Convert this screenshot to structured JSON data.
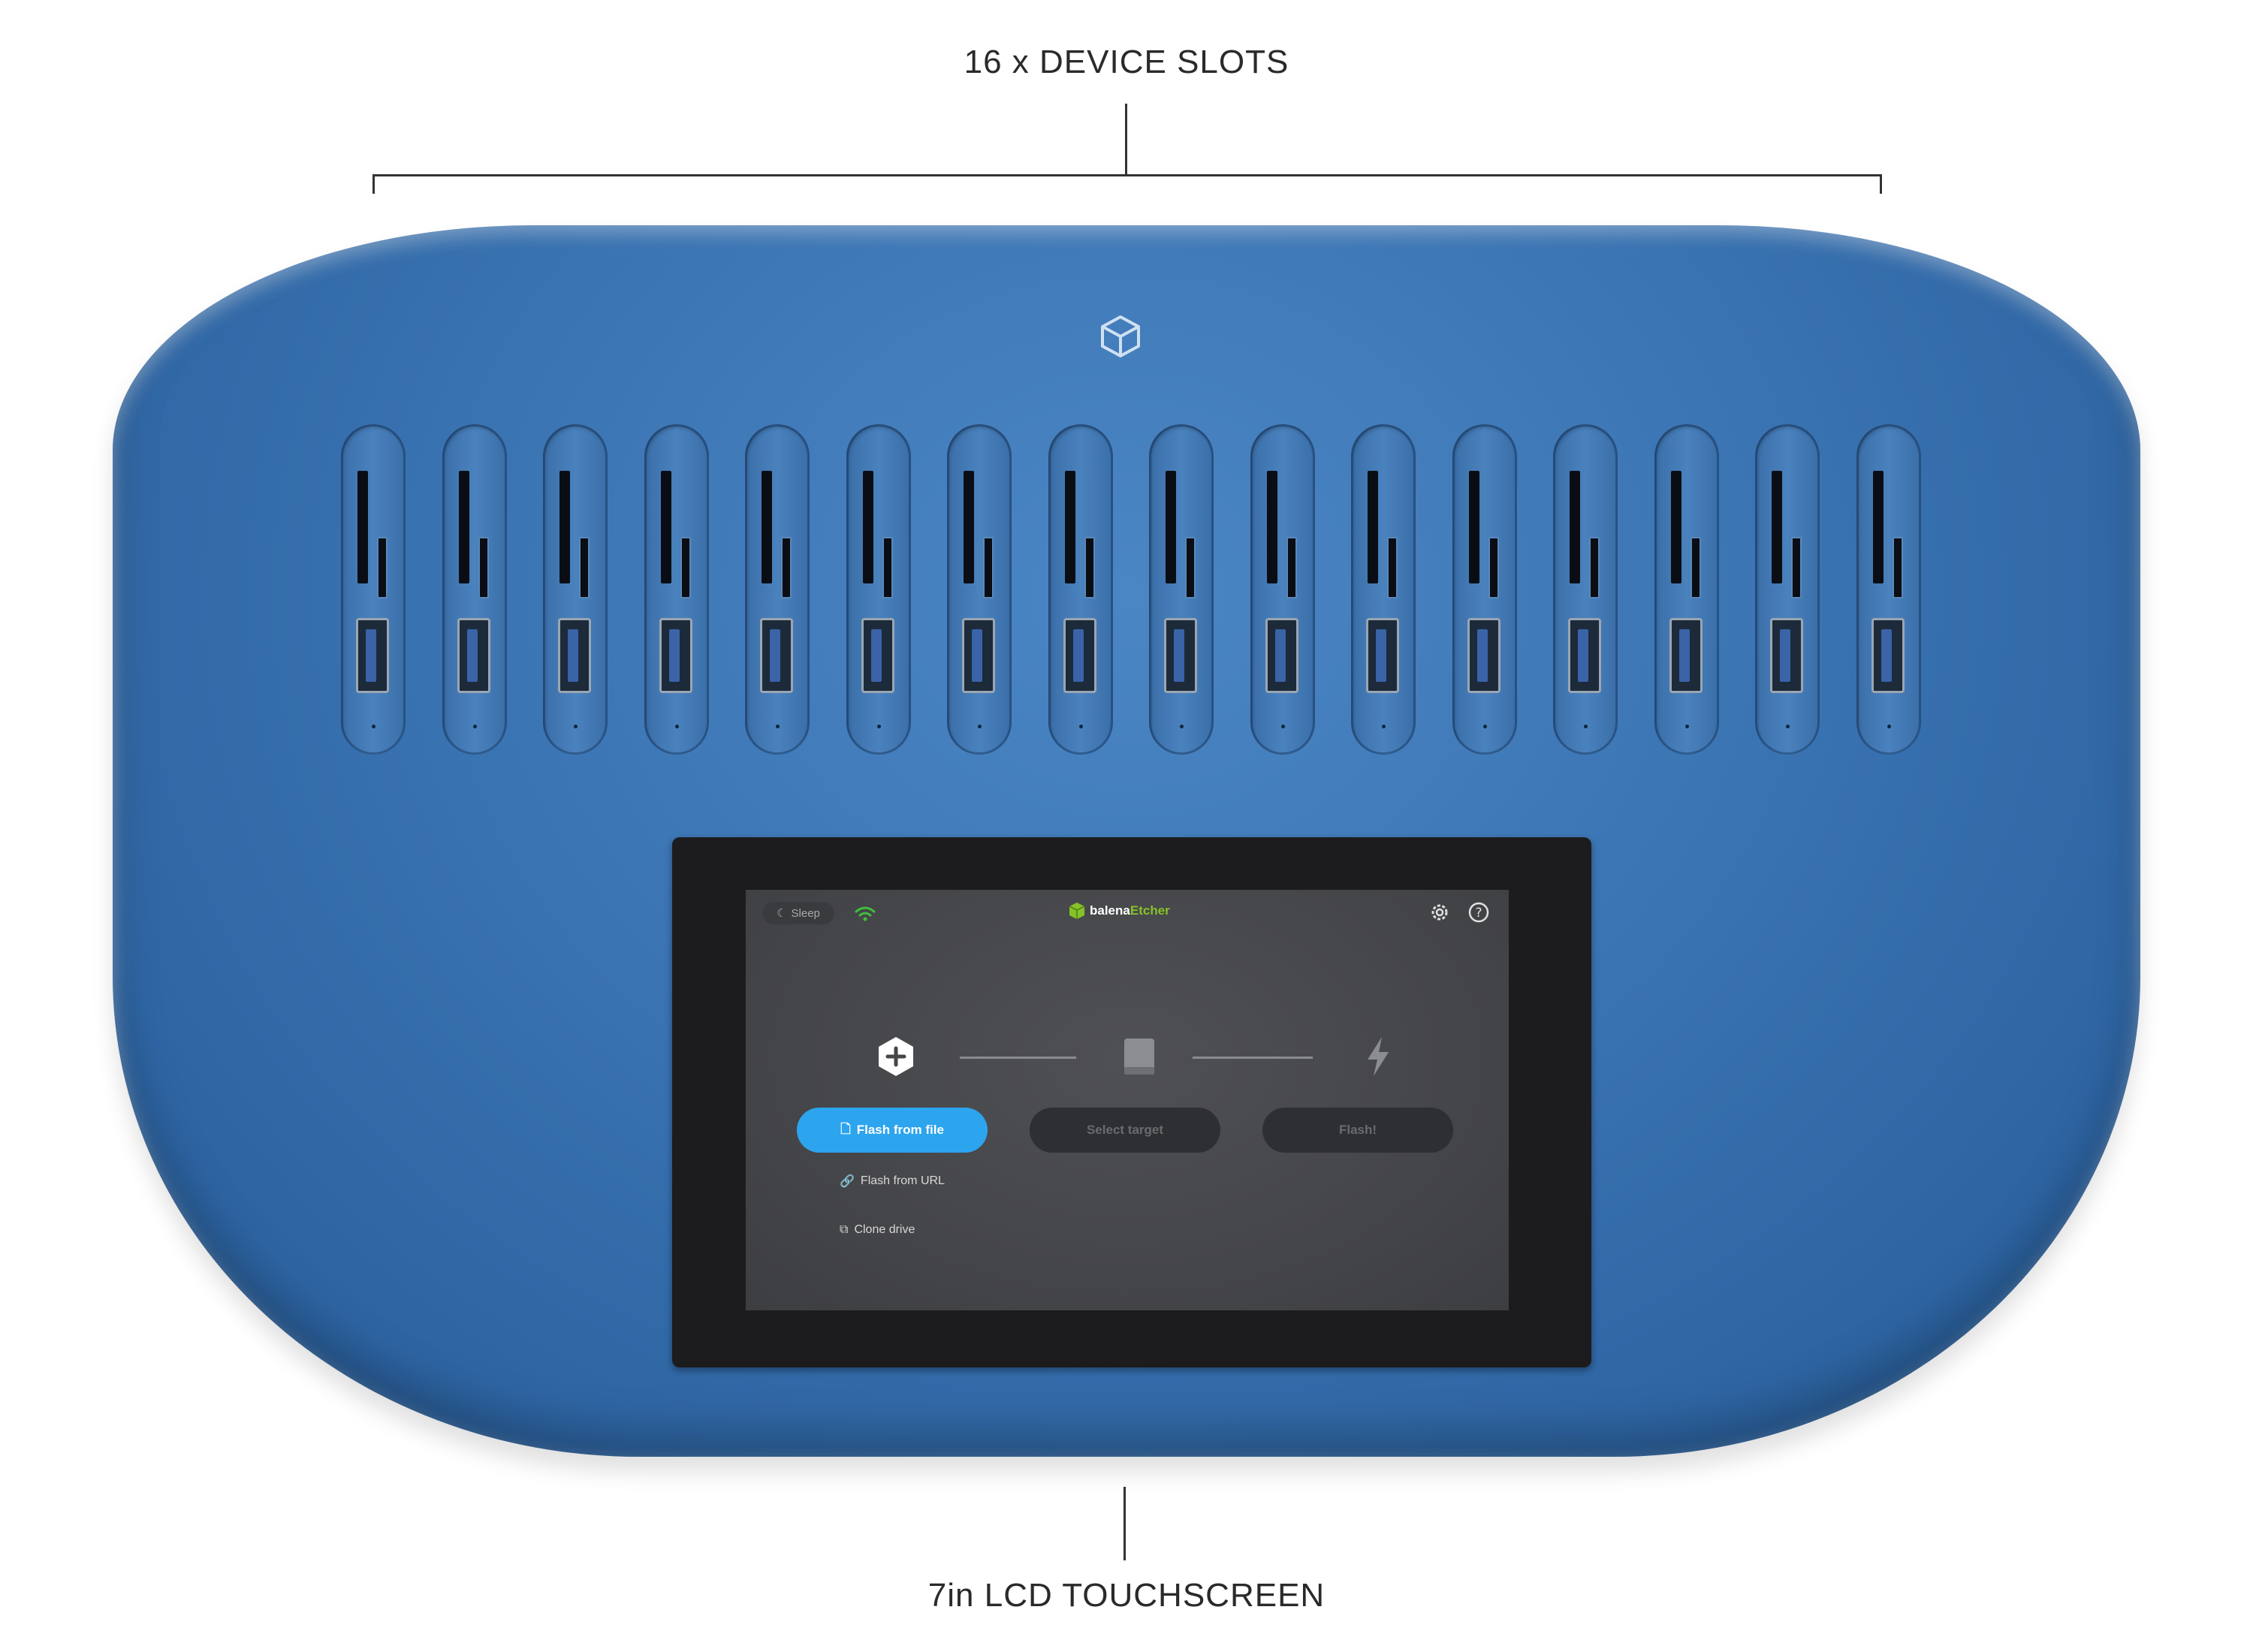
{
  "callouts": {
    "slots_label": "16 x DEVICE SLOTS",
    "screen_label": "7in LCD TOUCHSCREEN"
  },
  "device": {
    "slot_count": 16,
    "logo_icon": "box-icon",
    "color": "#3b74b3"
  },
  "screen": {
    "sleep_label": "Sleep",
    "brand_prefix": "balena",
    "brand_suffix": "Etcher",
    "icons": [
      "moon-icon",
      "wifi-icon",
      "settings-icon",
      "help-icon",
      "plus-hexagon-icon",
      "drive-icon",
      "lightning-icon",
      "file-icon",
      "link-icon",
      "copy-icon"
    ],
    "steps": {
      "flash_from_file": "Flash from file",
      "select_target": "Select target",
      "flash": "Flash!"
    },
    "options": {
      "flash_from_url": "Flash from URL",
      "clone_drive": "Clone drive"
    },
    "colors": {
      "accent": "#2da4ee",
      "brand_green": "#85c227",
      "wifi_green": "#3fbf3f"
    }
  }
}
